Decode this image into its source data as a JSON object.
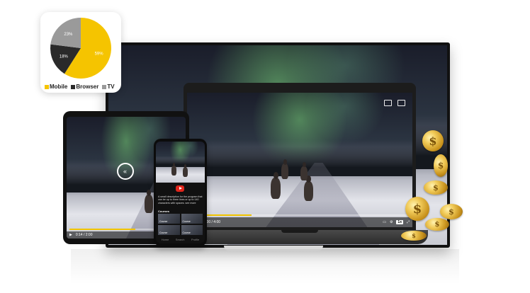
{
  "pie": {
    "slices": [
      {
        "label": "Mobile",
        "value": 59,
        "text": "59%",
        "color": "#f5c400"
      },
      {
        "label": "Browser",
        "value": 18,
        "text": "18%",
        "color": "#2a2a2a"
      },
      {
        "label": "TV",
        "value": 23,
        "text": "23%",
        "color": "#9a9a9a"
      }
    ],
    "legend": {
      "mobile": "Mobile",
      "browser": "Browser",
      "tv": "TV"
    }
  },
  "laptop": {
    "time": "0:00 / 4:00",
    "speed": "1x"
  },
  "tablet": {
    "time": "0:14 / 2:00"
  },
  "phone": {
    "desc": "A small description for the program that can be up to three lines or up to 140 characters with spaces. see more",
    "courses": "Courses",
    "thumbs": [
      "Course",
      "Course",
      "Course",
      "Course"
    ],
    "tabs": [
      "Home",
      "Search",
      "Profile"
    ]
  },
  "colors": {
    "accent": "#f2c400",
    "coin": "#e0b040"
  },
  "coin_symbol": "$"
}
